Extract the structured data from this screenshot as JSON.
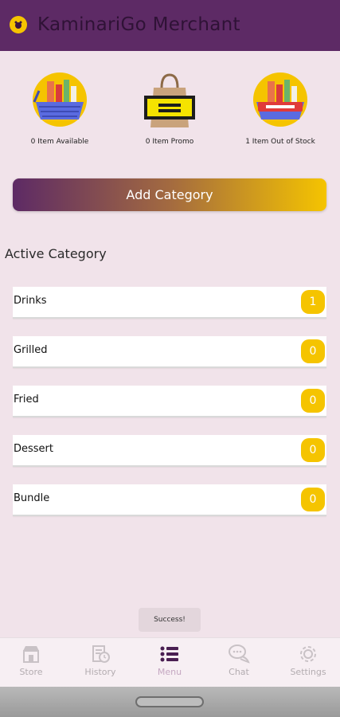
{
  "app": {
    "title": "KaminariGo Merchant"
  },
  "stats": [
    {
      "label": "0 Item Available",
      "icon": "grocery-basket-icon"
    },
    {
      "label": "0 Item Promo",
      "icon": "promo-bag-icon"
    },
    {
      "label": "1 Item Out of Stock",
      "icon": "out-of-stock-basket-icon"
    }
  ],
  "add_category_label": "Add Category",
  "section_title": "Active Category",
  "categories": [
    {
      "name": "Drinks",
      "count": "1"
    },
    {
      "name": "Grilled",
      "count": "0"
    },
    {
      "name": "Fried",
      "count": "0"
    },
    {
      "name": "Dessert",
      "count": "0"
    },
    {
      "name": "Bundle",
      "count": "0"
    }
  ],
  "toast": "Success!",
  "nav": [
    {
      "label": "Store",
      "icon": "store-icon"
    },
    {
      "label": "History",
      "icon": "history-icon"
    },
    {
      "label": "Menu",
      "icon": "menu-list-icon",
      "active": true
    },
    {
      "label": "Chat",
      "icon": "chat-icon"
    },
    {
      "label": "Settings",
      "icon": "gear-icon"
    }
  ],
  "colors": {
    "primary": "#5d2a65",
    "accent": "#f5c400",
    "background": "#f1e3ea"
  }
}
